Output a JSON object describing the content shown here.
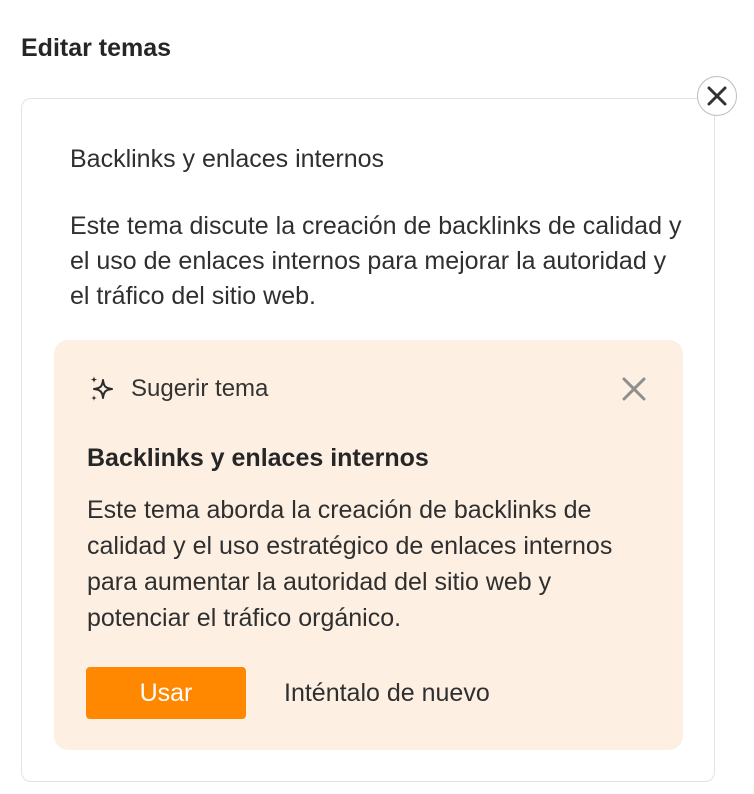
{
  "page": {
    "title": "Editar temas"
  },
  "topic": {
    "name": "Backlinks y enlaces internos",
    "description": "Este tema discute la creación de backlinks de calidad y el uso de enlaces internos para mejorar la autoridad y el tráfico del sitio web."
  },
  "suggestion": {
    "header_label": "Sugerir tema",
    "title": "Backlinks y enlaces internos",
    "description": "Este tema aborda la creación de backlinks de calidad y el uso estratégico de enlaces internos para aumentar la autoridad del sitio web y potenciar el tráfico orgánico.",
    "use_label": "Usar",
    "retry_label": "Inténtalo de nuevo"
  },
  "icons": {
    "card_close": "close-icon",
    "suggest_close": "close-icon",
    "sparkle": "sparkle-icon"
  },
  "colors": {
    "accent": "#ff8800",
    "suggest_bg": "#fdf0e3",
    "card_border": "#e3e3e3"
  }
}
